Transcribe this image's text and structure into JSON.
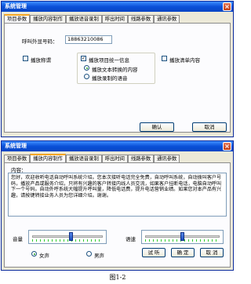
{
  "window1": {
    "title": "系统管理",
    "close_glyph": "×",
    "tabs": [
      "项目参数",
      "播放内容制作",
      "播放语音录制",
      "呼出时间",
      "线路参数",
      "通讯参数"
    ],
    "active_tab": 0,
    "caller_number": {
      "label": "呼叫外显号码：",
      "value": "18863210086"
    },
    "checkboxes": {
      "play_title": {
        "label": "播放称谓",
        "checked": false
      },
      "play_unified": {
        "label": "播放项目统一信息",
        "checked": true
      },
      "play_list": {
        "label": "播放清单内容",
        "checked": false
      }
    },
    "radios": [
      {
        "label": "播放文本转换的内容",
        "selected": true
      },
      {
        "label": "播放录制的语音",
        "selected": false
      }
    ],
    "buttons": {
      "ok": "确认",
      "cancel": "取消"
    }
  },
  "window2": {
    "title": "系统管理",
    "close_glyph": "×",
    "tabs": [
      "项目参数",
      "播放内容制作",
      "播放语音录制",
      "呼出时间",
      "线路参数",
      "通讯参数"
    ],
    "active_tab": 1,
    "content_label": "内容：",
    "content_text": "您好，欢迎收听电话自动呼叫系统介绍。您本次接听电话完全免费，自动呼叫系统，自动拨叫客户号码，播放产品或服务介绍，只将有兴趣的客户转接内线人员交流，如果客户挂断电话，电脑自动呼叫下一个号码。自动外呼系统大幅提升呼叫量，降低电话费，提升电话营销业绩。如果您对本产品有兴趣，请按键转接业务人员为您详细介绍。谢谢。",
    "volume_label": "音量",
    "volume_level": 0.55,
    "speed_label": "语速",
    "speed_level": 0.5,
    "voice_radios": [
      {
        "label": "女声",
        "selected": true
      },
      {
        "label": "男声",
        "selected": false
      }
    ],
    "buttons": {
      "test": "试 听",
      "ok": "确 定",
      "cancel": "取 消"
    }
  },
  "caption": "图1-2"
}
